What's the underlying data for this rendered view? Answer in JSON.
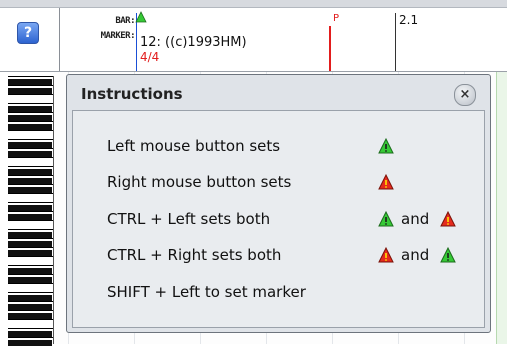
{
  "header": {
    "help_label": "?",
    "bar_label": "BAR:",
    "marker_label": "MARKER:",
    "bar_text": "12: ((c)1993HM)",
    "time_signature": "4/4",
    "p_label": "P",
    "bar_number": "2.1"
  },
  "dialog": {
    "title": "Instructions",
    "close_label": "×",
    "rows": [
      {
        "text": "Left mouse button sets",
        "icons": [
          "green-marker-icon"
        ]
      },
      {
        "text": "Right mouse button sets",
        "icons": [
          "red-marker-icon"
        ]
      },
      {
        "text": "CTRL + Left sets both",
        "icons": [
          "green-marker-icon",
          "red-marker-icon"
        ],
        "joiner": "and"
      },
      {
        "text": "CTRL + Right  sets both",
        "icons": [
          "red-marker-icon",
          "green-marker-icon"
        ],
        "joiner": "and"
      },
      {
        "text": "SHIFT + Left to set marker",
        "icons": []
      }
    ]
  },
  "colors": {
    "green_marker": "#36c936",
    "red_marker": "#e52a1e",
    "dialog_bg": "#dfe3e8",
    "start_line": "#1a4fd6",
    "p_line": "#e21d1d"
  }
}
